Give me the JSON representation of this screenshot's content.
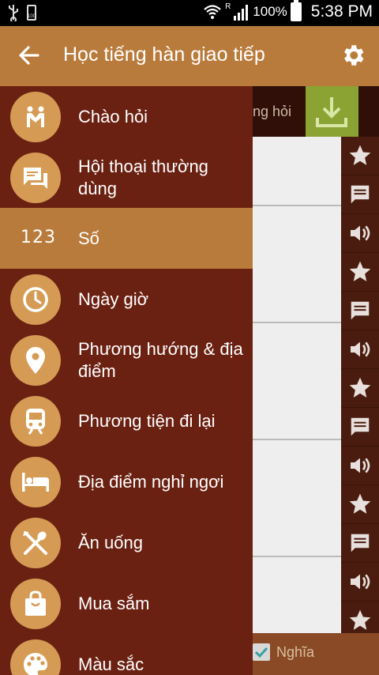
{
  "status_bar": {
    "battery_small": "100",
    "signal_letter": "R",
    "battery_percent": "100%",
    "time": "5:38 PM"
  },
  "app_bar": {
    "title": "Học tiếng hàn giao tiếp"
  },
  "background": {
    "tab_hint": "ng hỏi",
    "checkbox_label": "Nghĩa",
    "checkbox_checked": true
  },
  "drawer": {
    "selected": 2,
    "items": [
      {
        "label": "Chào hỏi",
        "icon": "greeting-people-icon"
      },
      {
        "label": "Hội thoại thường dùng",
        "icon": "chat-bubbles-icon"
      },
      {
        "label": "Số",
        "icon": "numbers-icon",
        "icon_text": "123"
      },
      {
        "label": "Ngày giờ",
        "icon": "clock-icon"
      },
      {
        "label": "Phương hướng & địa điểm",
        "icon": "location-pin-icon"
      },
      {
        "label": "Phương tiện đi lại",
        "icon": "train-icon"
      },
      {
        "label": "Địa điểm nghỉ ngơi",
        "icon": "hotel-bed-icon"
      },
      {
        "label": "Ăn uống",
        "icon": "fork-spoon-icon"
      },
      {
        "label": "Mua sắm",
        "icon": "shopping-bag-icon"
      },
      {
        "label": "Màu sắc",
        "icon": "palette-icon"
      }
    ]
  },
  "colors": {
    "accent": "#b97b3c",
    "drawer_bg": "#6b2112",
    "icon_circle": "#d59b54",
    "download_green": "#8aa333"
  }
}
